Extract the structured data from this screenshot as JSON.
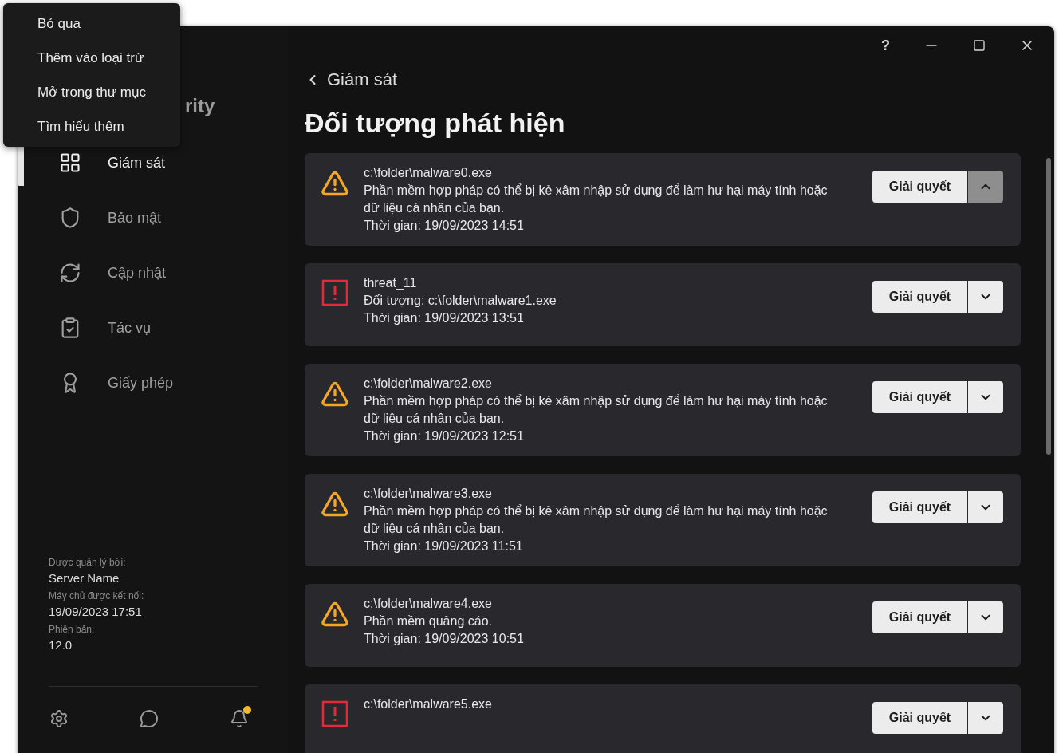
{
  "context_menu": {
    "items": [
      {
        "label": "Bỏ qua"
      },
      {
        "label": "Thêm vào loại trừ"
      },
      {
        "label": "Mở trong thư mục"
      },
      {
        "label": "Tìm hiểu thêm"
      }
    ]
  },
  "window": {
    "controls": {
      "help": "?"
    }
  },
  "sidebar": {
    "app_title": "rity",
    "items": [
      {
        "label": "Giám sát",
        "kind": "grid",
        "selected": true
      },
      {
        "label": "Bảo mật",
        "kind": "shield",
        "selected": false
      },
      {
        "label": "Cập nhật",
        "kind": "refresh",
        "selected": false
      },
      {
        "label": "Tác vụ",
        "kind": "clipboard",
        "selected": false
      },
      {
        "label": "Giấy phép",
        "kind": "award",
        "selected": false
      }
    ],
    "info": [
      {
        "label": "Được quản lý bởi:",
        "value": "Server Name"
      },
      {
        "label": "Máy chủ được kết nối:",
        "value": "19/09/2023 17:51"
      },
      {
        "label": "Phiên bản:",
        "value": "12.0"
      }
    ],
    "notifications": {
      "unread": true
    }
  },
  "breadcrumb": {
    "label": "Giám sát"
  },
  "page_title": "Đối tượng phát hiện",
  "detections": [
    {
      "kind": "warning",
      "title": "c:\\folder\\malware0.exe",
      "description": "Phần mềm hợp pháp có thể bị kẻ xâm nhập sử dụng để làm hư hại máy tính hoặc dữ liệu cá nhân của bạn.",
      "time": "Thời gian: 19/09/2023 14:51",
      "action": "Giải quyết",
      "expanded": true
    },
    {
      "kind": "threat",
      "title": "threat_11",
      "description": "Đối tượng: c:\\folder\\malware1.exe",
      "time": "Thời gian: 19/09/2023 13:51",
      "action": "Giải quyết",
      "expanded": false
    },
    {
      "kind": "warning",
      "title": "c:\\folder\\malware2.exe",
      "description": "Phần mềm hợp pháp có thể bị kẻ xâm nhập sử dụng để làm hư hại máy tính hoặc dữ liệu cá nhân của bạn.",
      "time": "Thời gian: 19/09/2023 12:51",
      "action": "Giải quyết",
      "expanded": false
    },
    {
      "kind": "warning",
      "title": "c:\\folder\\malware3.exe",
      "description": "Phần mềm hợp pháp có thể bị kẻ xâm nhập sử dụng để làm hư hại máy tính hoặc dữ liệu cá nhân của bạn.",
      "time": "Thời gian: 19/09/2023 11:51",
      "action": "Giải quyết",
      "expanded": false
    },
    {
      "kind": "warning",
      "title": "c:\\folder\\malware4.exe",
      "description": "Phần mềm quảng cáo.",
      "time": "Thời gian: 19/09/2023 10:51",
      "action": "Giải quyết",
      "expanded": false
    },
    {
      "kind": "threat",
      "title": "c:\\folder\\malware5.exe",
      "action": "Giải quyết",
      "expanded": false
    }
  ]
}
